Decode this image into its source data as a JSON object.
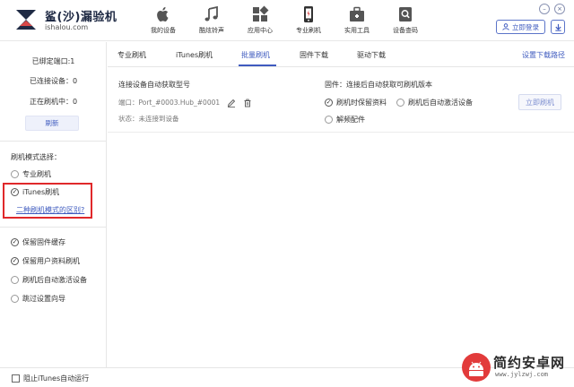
{
  "app": {
    "title": "鲨(沙)漏验机",
    "url": "ishalou.com"
  },
  "nav": [
    {
      "label": "我的设备",
      "icon": "apple-icon"
    },
    {
      "label": "酷炫铃声",
      "icon": "music-note-icon"
    },
    {
      "label": "应用中心",
      "icon": "apps-grid-icon"
    },
    {
      "label": "专业刷机",
      "icon": "phone-flash-icon",
      "active": true
    },
    {
      "label": "实用工具",
      "icon": "toolbox-icon"
    },
    {
      "label": "设备查码",
      "icon": "search-icon"
    }
  ],
  "window": {
    "minimize": "–",
    "close": "×"
  },
  "header": {
    "login_label": "立即登录"
  },
  "sidebar": {
    "bound_ports": "已绑定端口:1",
    "connected_devices": "已连接设备：0",
    "flashing": "正在刷机中：0",
    "refresh_label": "刷新",
    "mode_title": "刷机模式选择：",
    "mode_pro": "专业刷机",
    "mode_itunes": "iTunes刷机",
    "mode_diff_link": "二种刷机模式的区别?",
    "opt_keep_firmware_cache": "保留固件缓存",
    "opt_keep_user_data": "保留用户资料刷机",
    "opt_auto_activate": "刷机后自动激活设备",
    "opt_skip_setup": "跳过设置向导"
  },
  "tabs": [
    {
      "label": "专业刷机"
    },
    {
      "label": "iTunes刷机"
    },
    {
      "label": "批量刷机",
      "active": true
    },
    {
      "label": "固件下载"
    },
    {
      "label": "驱动下载"
    }
  ],
  "download_path_label": "设置下载路径",
  "main": {
    "auto_model_title": "连接设备自动获取型号",
    "port_label": "端口：",
    "port_value": "Port_#0003.Hub_#0001",
    "status_label": "状态：",
    "status_value": "未连接到设备",
    "firmware_title": "固件：",
    "firmware_value": "连接后自动获取可刷机版本",
    "opt_keep_data": "刷机时保留资料",
    "opt_auto_activate": "刷机后自动激活设备",
    "opt_unbrick": "解频配件",
    "flash_now_label": "立即刷机"
  },
  "bottom": {
    "block_itunes": "阻止iTunes自动运行"
  },
  "watermark": {
    "title": "简约安卓网",
    "url": "www.jylzwj.com"
  },
  "colors": {
    "accent": "#3f5bbf",
    "highlight_red": "#e0282a",
    "watermark_red": "#e23b3b"
  }
}
